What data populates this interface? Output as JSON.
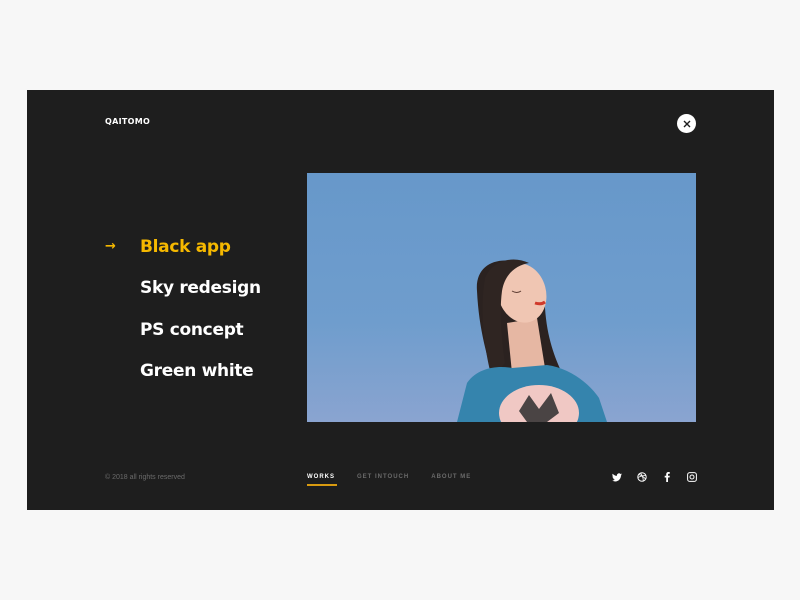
{
  "brand": {
    "logo": "QAITOMO"
  },
  "close_label": "×",
  "menu": {
    "active_arrow": "→",
    "items": [
      {
        "label": "Black app",
        "active": true
      },
      {
        "label": "Sky redesign",
        "active": false
      },
      {
        "label": "PS concept",
        "active": false
      },
      {
        "label": "Green white",
        "active": false
      }
    ]
  },
  "preview": {
    "alt": "Woman in blue sweater against blue sky"
  },
  "footer": {
    "copyright": "©  2018 all rights reserved",
    "nav": [
      {
        "label": "WORKS",
        "active": true
      },
      {
        "label": "GET INTOUCH",
        "active": false
      },
      {
        "label": "ABOUT ME",
        "active": false
      }
    ],
    "social": [
      "twitter-icon",
      "dribbble-icon",
      "facebook-icon",
      "instagram-icon"
    ]
  },
  "colors": {
    "accent": "#f5b800",
    "panel": "#1e1e1e",
    "background": "#f7f7f7"
  }
}
